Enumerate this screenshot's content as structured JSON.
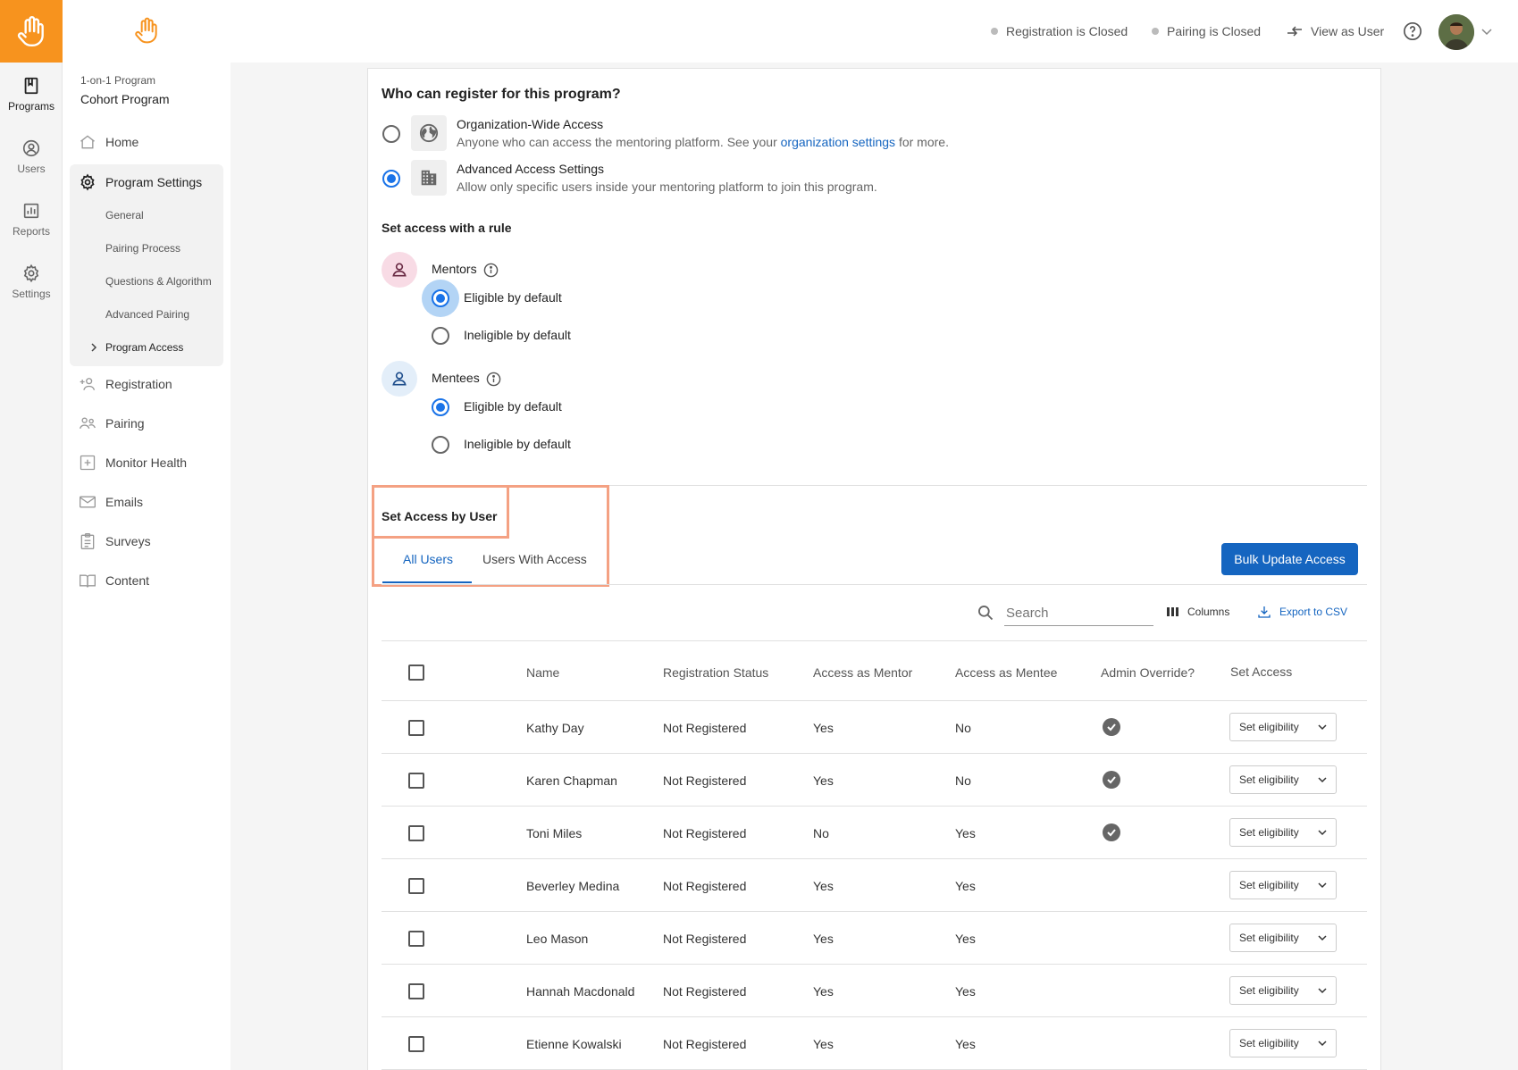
{
  "rail": {
    "items": [
      {
        "label": "Programs"
      },
      {
        "label": "Users"
      },
      {
        "label": "Reports"
      },
      {
        "label": "Settings"
      }
    ]
  },
  "sidebar": {
    "program_type": "1-on-1 Program",
    "program_name": "Cohort Program",
    "nav": {
      "home": "Home",
      "program_settings": "Program Settings",
      "general": "General",
      "pairing_process": "Pairing Process",
      "questions_algorithm": "Questions & Algorithm",
      "advanced_pairing": "Advanced Pairing",
      "program_access": "Program Access",
      "registration": "Registration",
      "pairing": "Pairing",
      "monitor_health": "Monitor Health",
      "emails": "Emails",
      "surveys": "Surveys",
      "content": "Content"
    }
  },
  "topbar": {
    "registration_status": "Registration is Closed",
    "pairing_status": "Pairing is Closed",
    "view_as_user": "View as User"
  },
  "register": {
    "heading": "Who can register for this program?",
    "org_wide_title": "Organization-Wide Access",
    "org_wide_desc_pre": "Anyone who can access the mentoring platform. See your",
    "org_wide_link": "organization settings",
    "org_wide_desc_post": "for more.",
    "advanced_title": "Advanced Access Settings",
    "advanced_desc": "Allow only specific users inside your mentoring platform to join this program.",
    "selected": "advanced"
  },
  "rule": {
    "heading": "Set access with a rule",
    "mentors_label": "Mentors",
    "mentees_label": "Mentees",
    "eligible": "Eligible by default",
    "ineligible": "Ineligible by default",
    "mentors_selected": "eligible",
    "mentees_selected": "eligible"
  },
  "by_user": {
    "heading": "Set Access by User",
    "tabs": [
      "All Users",
      "Users With Access"
    ],
    "active_tab": "All Users",
    "bulk_button": "Bulk Update Access",
    "search_placeholder": "Search",
    "columns_label": "Columns",
    "export_label": "Export to CSV"
  },
  "table": {
    "headers": {
      "name": "Name",
      "registration_status": "Registration Status",
      "access_mentor": "Access as Mentor",
      "access_mentee": "Access as Mentee",
      "admin_override": "Admin Override?",
      "set_access": "Set Access"
    },
    "set_button": "Set eligibility",
    "rows": [
      {
        "name": "Kathy Day",
        "status": "Not Registered",
        "mentor": "Yes",
        "mentee": "No",
        "override": true
      },
      {
        "name": "Karen Chapman",
        "status": "Not Registered",
        "mentor": "Yes",
        "mentee": "No",
        "override": true
      },
      {
        "name": "Toni Miles",
        "status": "Not Registered",
        "mentor": "No",
        "mentee": "Yes",
        "override": true
      },
      {
        "name": "Beverley Medina",
        "status": "Not Registered",
        "mentor": "Yes",
        "mentee": "Yes",
        "override": false
      },
      {
        "name": "Leo Mason",
        "status": "Not Registered",
        "mentor": "Yes",
        "mentee": "Yes",
        "override": false
      },
      {
        "name": "Hannah Macdonald",
        "status": "Not Registered",
        "mentor": "Yes",
        "mentee": "Yes",
        "override": false
      },
      {
        "name": "Etienne Kowalski",
        "status": "Not Registered",
        "mentor": "Yes",
        "mentee": "Yes",
        "override": false
      }
    ]
  },
  "colors": {
    "brand_orange": "#f7931e",
    "primary_blue": "#1a73e8",
    "button_blue": "#1565c0",
    "highlight": "#f4a183"
  }
}
